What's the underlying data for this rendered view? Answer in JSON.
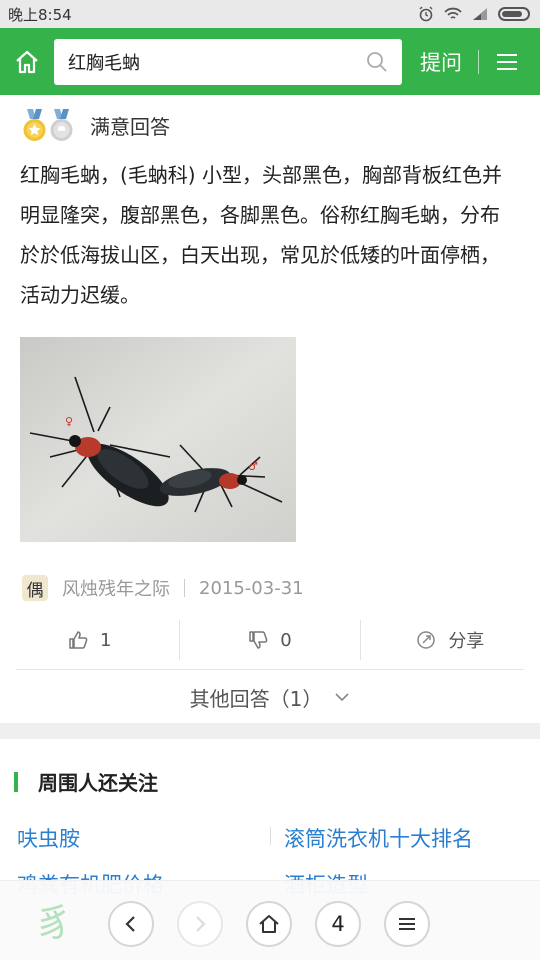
{
  "status_bar": {
    "time": "晚上8:54"
  },
  "header": {
    "search_value": "红胸毛蚋",
    "ask_label": "提问"
  },
  "answer": {
    "badge_label": "满意回答",
    "text": "红胸毛蚋，(毛蚋科) 小型，头部黑色，胸部背板红色并明显隆突，腹部黑色，各脚黑色。俗称红胸毛蚋，分布於於低海拔山区，白天出现，常见於低矮的叶面停栖，活动力迟缓。",
    "author": {
      "avatar_char": "偶",
      "name": "风烛残年之际",
      "date": "2015-03-31"
    },
    "likes": "1",
    "dislikes": "0",
    "share_label": "分享",
    "other_answers_label": "其他回答（1）"
  },
  "related": {
    "title": "周围人还关注",
    "links": [
      "呋虫胺",
      "滚筒洗衣机十大排名",
      "鸡粪有机肥价格",
      "酒柜造型"
    ]
  },
  "toolbar": {
    "tab_count": "4"
  },
  "colors": {
    "brand_green": "#36b24a",
    "link_blue": "#2a7fd1"
  }
}
